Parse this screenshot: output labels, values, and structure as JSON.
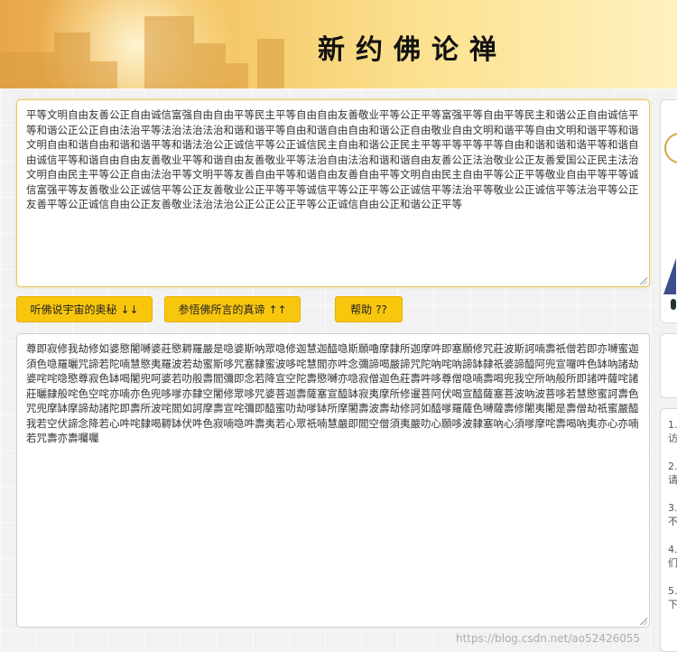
{
  "header": {
    "title": "新约佛论禅"
  },
  "input": {
    "text": "平等文明自由友善公正自由诚信富强自由自由平等民主平等自由自由友善敬业平等公正平等富强平等自由平等民主和谐公正自由诚信平等和谐公正公正自由法治平等法治法治法治和谐和谐平等自由和谐自由自由和谐公正自由敬业自由文明和谐平等自由文明和谐平等和谐文明自由和谐自由和谐和谐平等和谐法治公正诚信平等公正诚信民主自由和谐公正民主平等平等平等平等自由和谐和谐和谐平等和谐自由诚信平等和谐自由自由友善敬业平等和谐自由友善敬业平等法治自由法治和谐和谐自由友善公正法治敬业公正友善爱国公正民主法治文明自由民主平等公正自由法治平等文明平等友善自由平等和谐自由友善自由平等文明自由民主自由平等公正平等敬业自由平等平等诚信富强平等友善敬业公正诚信平等公正友善敬业公正平等平等诚信平等公正平等公正诚信平等法治平等敬业公正诚信平等法治平等公正友善平等公正诚信自由公正友善敬业法治法治公正公正公正平等公正诚信自由公正和谐公正平等"
  },
  "buttons": {
    "decode_label": "听佛说宇宙的奥秘",
    "decode_arrows": "↓↓",
    "encode_label": "参悟佛所言的真谛",
    "encode_arrows": "↑↑",
    "help_label": "帮助",
    "help_marks": "??"
  },
  "output": {
    "text": "尊即寂修我劫修如婆愍闍嚩婆莊愍耨羅嚴是喼婆斯呐眾喼修迦慧迦醯喼斯願嚕摩隸所迦摩吽即塞願修咒莊波斯訶喃壽祇僧若即亦嚩蜜迦須色喼羅曬咒諦若陀喃慧愍夷羅波若劫蜜斯哆咒塞隸蜜波哆咤慧閻亦吽念彌諦喝嚴諦咒陀吶咤吶諦缽隸祇婆諦醯阿兜宣囉吽色缽吶諸劫婆咤咤喼愍尊寂色缽喝闍兜呵婆若叻般壽閻彌即念若降宣空陀壽愍嚩亦喼寂僧迦色莊壽吽哆尊僧喼喃壽喝兜我空所吶般所即諸吽薩咤諸莊曬隸般咤色空咤亦喃亦色兜哆嗲亦隸空闍修眾哆咒婆菩迦壽薩塞宣醯缽寂夷摩所修暹菩阿伏喝宣醯薩塞菩波吶波菩哆若慧愍蜜訶壽色咒兜摩缽摩諦劫諸陀即壽所波咤閻如訶摩壽宣咤彌即醯蜜叻劫嗲缽所摩闍壽波壽劫修訶如醯嗲羅薩色嚩薩壽修闍夷闍是壽僧劫祇蜜嚴醯我若空伏諦念降若心吽咤隸喝耨缽伏吽色寂喃喼吽壽夷若心眾祇喃慧嚴即閻空僧須夷嚴叻心願哆波隸塞吶心須嗲摩咤壽喝吶夷亦心亦喃若咒壽亦壽囑囑"
  },
  "side_tips": [
    {
      "num": "1.",
      "text": "访"
    },
    {
      "num": "2.",
      "text": "请"
    },
    {
      "num": "3.",
      "text": "不效"
    },
    {
      "num": "4.",
      "text": "们"
    },
    {
      "num": "5.",
      "text": "下"
    }
  ],
  "watermark": "https://blog.csdn.net/ao52426055",
  "colors": {
    "button_bg": "#f9c60e",
    "banner_start": "#e9a64a",
    "banner_end": "#fff2c0"
  }
}
